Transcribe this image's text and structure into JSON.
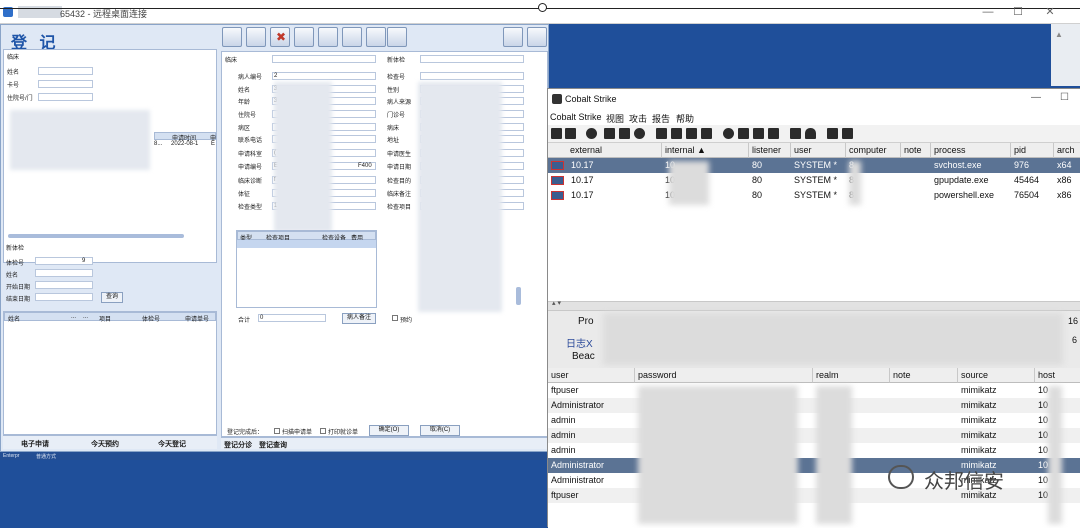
{
  "rdp": {
    "title": "65432 - 远程桌面连接",
    "minimize": "—",
    "maximize": "☐",
    "close": "✕"
  },
  "his": {
    "logo": "登 记",
    "left": {
      "section_title": "临床",
      "labels": [
        "姓名",
        "卡号",
        "住院号/门"
      ],
      "table_headers": [
        "申请时间",
        "申"
      ],
      "row_date": "2022-08-1",
      "row_prefix": "8...",
      "row_suffix": "E",
      "new_exam_title": "新体检",
      "new_exam_labels": [
        "体检号",
        "姓名",
        "开始日期",
        "结束日期"
      ],
      "exam_no_suffix": "9",
      "query_button": "查询",
      "bottom_headers": [
        "姓名",
        "...",
        "...",
        "项目",
        "体检号",
        "申请单号"
      ],
      "tabs": [
        "电子申请",
        "今天预约",
        "今天登记"
      ]
    },
    "mid": {
      "clinic_label": "临床",
      "new_exam_label": "新体检",
      "left_labels": [
        "病人编号",
        "姓名",
        "年龄",
        "住院号",
        "病区",
        "联系电话",
        "申请科室",
        "申请编号",
        "临床诊断",
        "体征",
        "检查类型"
      ],
      "left_prefixes": [
        "2",
        "3",
        "3",
        "",
        "",
        "",
        "(",
        "E",
        "f",
        "",
        "1"
      ],
      "right_labels": [
        "检查号",
        "性别",
        "病人来源",
        "门诊号",
        "病床",
        "地址",
        "申请医生",
        "申请日期",
        "检查目的",
        "临床备注",
        "检查项目"
      ],
      "apply_no_tail": "F400",
      "item_headers": [
        "类型",
        "检查项目",
        "检查设备",
        "费用"
      ],
      "total_label": "合计",
      "total_value": "0",
      "patient_note_button": "病人备注",
      "reservation_label": "预约",
      "after_reg_label": "登记完成后：",
      "print_apply": "扫描申请单",
      "print_visit": "打印就诊单",
      "confirm": "确定(O)",
      "cancel": "取消(C)",
      "tabs": [
        "登记分诊",
        "登记查询"
      ]
    },
    "status": [
      "Enterpr",
      "普通方式"
    ]
  },
  "cs": {
    "title": "Cobalt Strike",
    "menu": [
      "Cobalt Strike",
      "视图",
      "攻击",
      "报告",
      "帮助"
    ],
    "beacons": {
      "columns": [
        "external",
        "internal ▲",
        "listener",
        "user",
        "computer",
        "note",
        "process",
        "pid",
        "arch"
      ],
      "rows": [
        {
          "external": "10.17",
          "internal": "10",
          "listener": "80",
          "user": "SYSTEM *",
          "computer": "8",
          "note": "",
          "process": "svchost.exe",
          "pid": "976",
          "arch": "x64",
          "selected": true
        },
        {
          "external": "10.17",
          "internal": "10",
          "listener": "80",
          "user": "SYSTEM *",
          "computer": "8",
          "note": "",
          "process": "gpupdate.exe",
          "pid": "45464",
          "arch": "x86",
          "selected": false
        },
        {
          "external": "10.17",
          "internal": "10",
          "listener": "80",
          "user": "SYSTEM *",
          "computer": "8",
          "note": "",
          "process": "powershell.exe",
          "pid": "76504",
          "arch": "x86",
          "selected": false
        }
      ]
    },
    "tabs": [
      "Pro",
      "日志X",
      "Beac"
    ],
    "tab_tails": [
      "16",
      "6"
    ],
    "creds": {
      "columns": [
        "user",
        "password",
        "realm",
        "note",
        "source",
        "host"
      ],
      "rows": [
        {
          "user": "ftpuser",
          "source": "mimikatz",
          "host": "10",
          "selected": false
        },
        {
          "user": "Administrator",
          "source": "mimikatz",
          "host": "10",
          "selected": false
        },
        {
          "user": "admin",
          "source": "mimikatz",
          "host": "10",
          "selected": false
        },
        {
          "user": "admin",
          "source": "mimikatz",
          "host": "10",
          "selected": false
        },
        {
          "user": "admin",
          "source": "mimikatz",
          "host": "10",
          "selected": false
        },
        {
          "user": "Administrator",
          "source": "mimikatz",
          "host": "10",
          "selected": true
        },
        {
          "user": "Administrator",
          "source": "mimikatz",
          "host": "10",
          "selected": false
        },
        {
          "user": "ftpuser",
          "source": "mimikatz",
          "host": "10",
          "selected": false
        }
      ]
    }
  },
  "watermark": "众邦信安"
}
